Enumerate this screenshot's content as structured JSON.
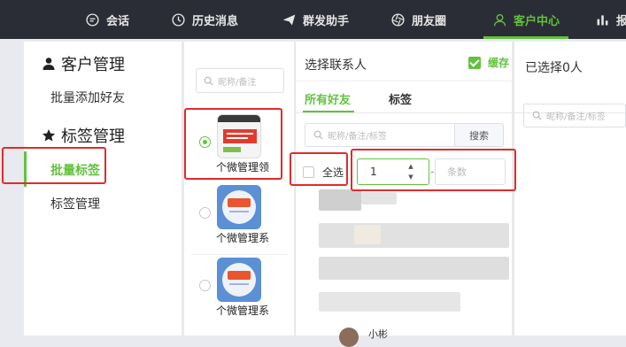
{
  "nav": {
    "items": [
      {
        "label": "会话",
        "icon": "chat-icon"
      },
      {
        "label": "历史消息",
        "icon": "clock-icon"
      },
      {
        "label": "群发助手",
        "icon": "send-icon"
      },
      {
        "label": "朋友圈",
        "icon": "aperture-icon"
      },
      {
        "label": "客户中心",
        "icon": "user-icon",
        "active": true
      },
      {
        "label": "报",
        "icon": "bar-chart-icon"
      }
    ]
  },
  "sidebar": {
    "customer_heading": "客户管理",
    "batch_add": "批量添加好友",
    "tag_heading": "标签管理",
    "batch_tag": "批量标签",
    "tag_manage": "标签管理"
  },
  "groups": {
    "search_placeholder": "昵称/备注",
    "items": [
      {
        "name": "个微管理领",
        "selected": true
      },
      {
        "name": "个微管理系",
        "selected": false
      },
      {
        "name": "个微管理系",
        "selected": false
      }
    ]
  },
  "select": {
    "title": "选择联系人",
    "cache_label": "缓存",
    "tab_all": "所有好友",
    "tab_tags": "标签",
    "search_placeholder": "昵称/备注/标签",
    "search_button": "搜索",
    "select_all": "全选",
    "start_value": "1",
    "dash": "-",
    "count_placeholder": "条数",
    "last_friend_name": "小彬"
  },
  "selected": {
    "title": "已选择0人",
    "search_placeholder": "昵称/备注/标签"
  },
  "colors": {
    "accent": "#62c23d",
    "nav_bg": "#2b2d36",
    "annotation": "#e02c2c"
  }
}
